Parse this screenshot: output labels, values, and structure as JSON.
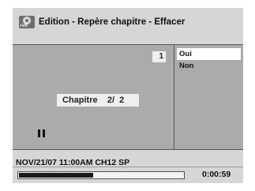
{
  "header": {
    "icon": "dvd-vr-disc-icon",
    "icon_tag": "+VR",
    "title": "Edition - Repère chapitre - Effacer"
  },
  "preview": {
    "number_badge": "1",
    "chapter_label": "Chapitre    2/  2",
    "state_icon": "pause-icon"
  },
  "menu": {
    "options": [
      {
        "label": "Oui",
        "selected": true
      },
      {
        "label": "Non",
        "selected": false
      }
    ]
  },
  "status": {
    "info": "NOV/21/07 11:00AM CH12 SP",
    "time": "0:00:59",
    "progress": 0.45
  },
  "colors": {
    "screen_bg": "#d6d6d6",
    "panel_bg": "#ababab",
    "selection_bg": "#ffffff",
    "progress_fill": "#1a1a1a"
  }
}
